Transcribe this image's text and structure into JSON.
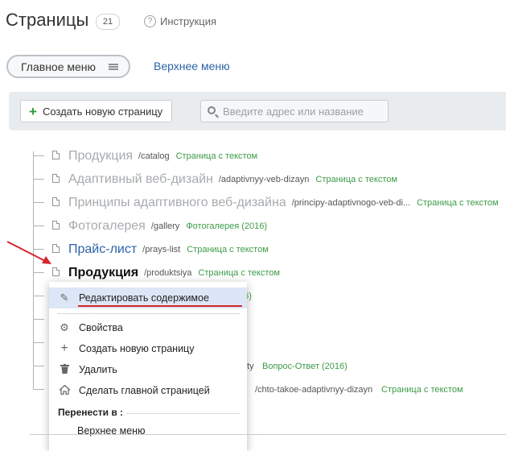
{
  "header": {
    "title": "Страницы",
    "count": "21",
    "help_label": "Инструкция",
    "help_icon": "question-circle-icon"
  },
  "menus": {
    "active": "Главное меню",
    "other": "Верхнее меню"
  },
  "toolbar": {
    "create_label": "Создать новую страницу",
    "search_placeholder": "Введите адрес или название"
  },
  "tree": [
    {
      "name": "Продукция",
      "path": "/catalog",
      "type": "Страница с текстом",
      "style": "muted"
    },
    {
      "name": "Адаптивный веб-дизайн",
      "path": "/adaptivnyy-veb-dizayn",
      "type": "Страница с текстом",
      "style": "muted"
    },
    {
      "name": "Принципы адаптивного веб-дизайна",
      "path": "/principy-adaptivnogo-veb-di...",
      "type": "Страница с текстом",
      "style": "muted"
    },
    {
      "name": "Фотогалерея",
      "path": "/gallery",
      "type": "Фотогалерея (2016)",
      "style": "muted"
    },
    {
      "name": "Прайс-лист",
      "path": "/prays-list",
      "type": "Страница с текстом",
      "style": "link"
    },
    {
      "name": "Продукция",
      "path": "/produktsiya",
      "type": "Страница с текстом",
      "style": "selected"
    }
  ],
  "hidden_rows": {
    "row7_type_fragment": "16)",
    "row10_path_fragment": "ty",
    "row10_type": "Вопрос-Ответ (2016)",
    "row11_path": "/chto-takoe-adaptivnyy-dizayn",
    "row11_type": "Страница с текстом"
  },
  "context_menu": {
    "items": [
      {
        "label": "Редактировать содержимое",
        "icon": "pencil-icon"
      },
      {
        "label": "Свойства",
        "icon": "gear-icon"
      },
      {
        "label": "Создать новую страницу",
        "icon": "plus-icon"
      },
      {
        "label": "Удалить",
        "icon": "trash-icon"
      },
      {
        "label": "Сделать главной страницей",
        "icon": "home-icon"
      }
    ],
    "move_label": "Перенести в :",
    "move_target": "Верхнее меню"
  },
  "colors": {
    "link": "#2d63a9",
    "muted_text": "#a7abaf",
    "type_green": "#3d9b48",
    "highlight": "#dde6f6",
    "annotation_red": "#d7262a"
  }
}
